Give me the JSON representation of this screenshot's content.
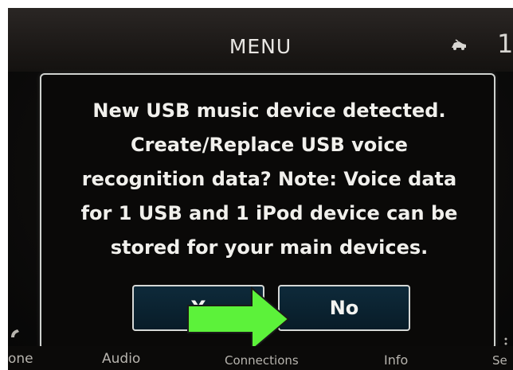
{
  "header": {
    "title": "MENU",
    "car_icon": "car-icon",
    "right_glyph": "1"
  },
  "dialog": {
    "message_lines": [
      "New USB music device detected.",
      "Create/Replace USB voice",
      "recognition data? Note: Voice data",
      "for 1 USB and 1 iPod device can be",
      "stored for your main devices."
    ],
    "yes_label": "Y",
    "no_label": "No"
  },
  "annotation": {
    "arrow_icon": "arrow-right-icon",
    "arrow_color": "#5cf23a"
  },
  "bottom_tabs": [
    "one",
    "Audio",
    "Connections",
    "Info",
    "Se"
  ],
  "colors": {
    "background": "#0d0c0b",
    "dialog_border": "#cfd2cf",
    "button_fill": "#0e2a3a",
    "text": "#f1f0ec"
  }
}
